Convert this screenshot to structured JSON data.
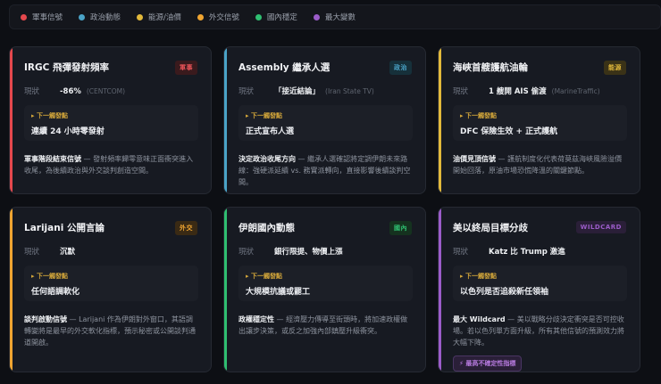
{
  "legend": [
    {
      "label": "軍事信號",
      "color": "#e5484d"
    },
    {
      "label": "政治動態",
      "color": "#4aa3c7"
    },
    {
      "label": "能源/油價",
      "color": "#e2b93b"
    },
    {
      "label": "外交信號",
      "color": "#f0a531"
    },
    {
      "label": "國內穩定",
      "color": "#2fbf71"
    },
    {
      "label": "最大變數",
      "color": "#9b5cc9"
    }
  ],
  "status_label": "現狀",
  "next_label": "▸ 下一觸發點",
  "cards": [
    {
      "title": "IRGC 飛彈發射頻率",
      "tag": "軍事",
      "color": "#e5484d",
      "tag_bg": "#3a1a1d",
      "tag_fg": "#f0555a",
      "status": "-86%",
      "source": "(CENTCOM)",
      "next": "連續 24 小時零發射",
      "desc_head": "軍事階段結束信號",
      "desc": " — 發射頻率歸零意味正面衝突進入收尾，為後續政治與外交談判創造空間。"
    },
    {
      "title": "Assembly 繼承人選",
      "tag": "政治",
      "color": "#4aa3c7",
      "tag_bg": "#16303a",
      "tag_fg": "#4aa3c7",
      "status": "「接近結論」",
      "source": "(Iran State TV)",
      "next": "正式宣布人選",
      "desc_head": "決定政治收尾方向",
      "desc": " — 繼承人選確認將定調伊朗未來路線：強硬派延續 vs. 務實派轉向，直接影響後續談判空間。"
    },
    {
      "title": "海峽首艘護航油輪",
      "tag": "能源",
      "color": "#e2b93b",
      "tag_bg": "#3a3217",
      "tag_fg": "#e2b93b",
      "status": "1 艘開 AIS 偷渡",
      "source": "(MarineTraffic)",
      "next": "DFC 保險生效 + 正式護航",
      "desc_head": "油價見頂信號",
      "desc": " — 護航制度化代表荷莫茲海峽風險溢價開始回落，原油市場恐慌降溫的關鍵節點。"
    },
    {
      "title": "Larijani 公開言論",
      "tag": "外交",
      "color": "#f0a531",
      "tag_bg": "#3a2a14",
      "tag_fg": "#f0a531",
      "status": "沉默",
      "source": "",
      "next": "任何語調軟化",
      "desc_head": "談判啟動信號",
      "desc": " — Larijani 作為伊朗對外窗口，其語調轉變將是最早的外交軟化指標，預示秘密或公開談判通道開啟。"
    },
    {
      "title": "伊朗國內動態",
      "tag": "國內",
      "color": "#2fbf71",
      "tag_bg": "#15321f",
      "tag_fg": "#2fbf71",
      "status": "銀行限提、物價上漲",
      "source": "",
      "next": "大規模抗議或罷工",
      "desc_head": "政權穩定性",
      "desc": " — 經濟壓力傳導至街頭時，將加速政權做出讓步決策，或反之加強內部鎮壓升級衝突。"
    },
    {
      "title": "美以終局目標分歧",
      "tag": "WILDCARD",
      "color": "#9b5cc9",
      "tag_bg": "#2a1f38",
      "tag_fg": "#9b5cc9",
      "status": "Katz 比 Trump 激進",
      "source": "",
      "next": "以色列是否追殺新任領袖",
      "desc_head": "最大 Wildcard",
      "desc": " — 美以戰略分歧決定衝突是否可控收場。若以色列單方面升級，所有其他信號的預測效力將大幅下降。",
      "badge": "⚡ 最高不確定性指標"
    }
  ]
}
